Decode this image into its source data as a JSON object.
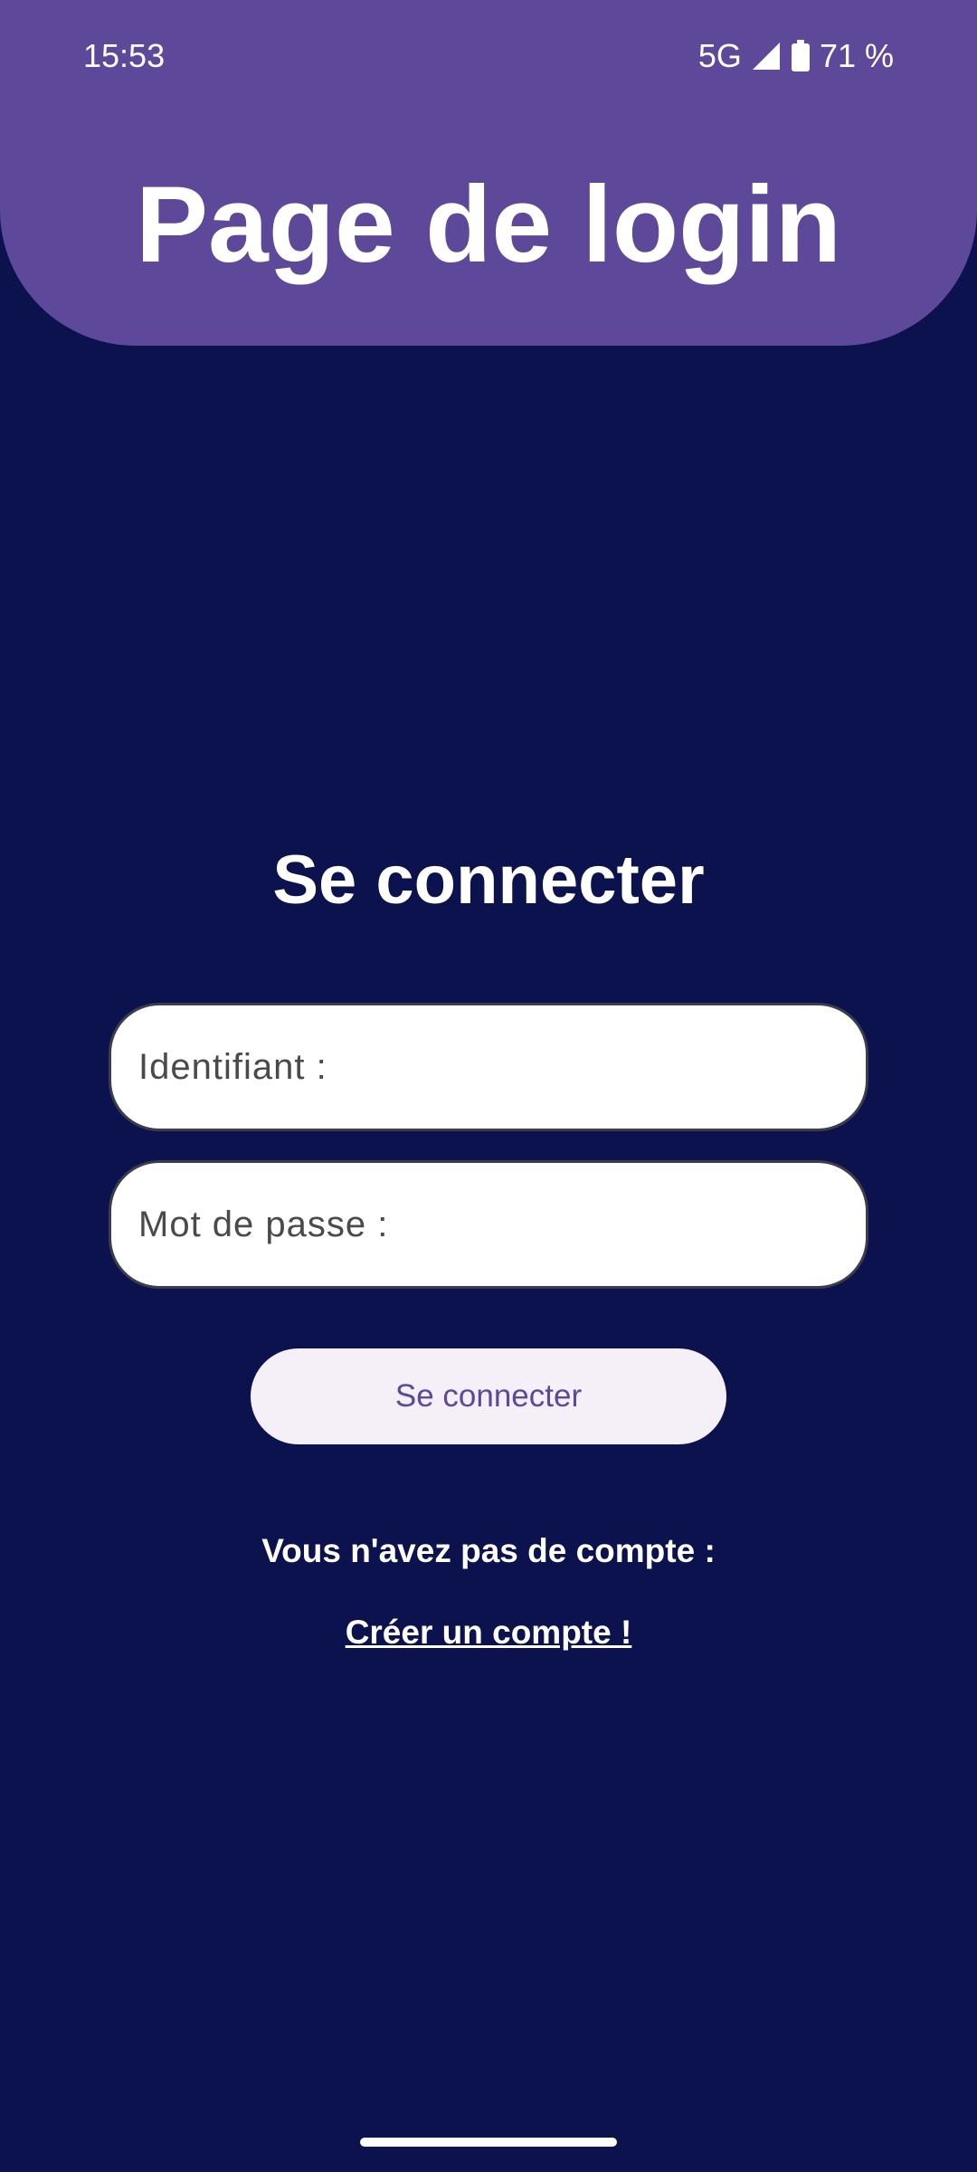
{
  "status_bar": {
    "time": "15:53",
    "network": "5G",
    "battery": "71 %"
  },
  "header": {
    "title": "Page de login"
  },
  "login_form": {
    "title": "Se connecter",
    "username_placeholder": "Identifiant :",
    "password_placeholder": "Mot de passe :",
    "submit_label": "Se connecter"
  },
  "signup": {
    "prompt": "Vous n'avez pas de compte :",
    "link_label": "Créer un compte !"
  },
  "icons": {
    "signal": "signal-icon",
    "battery": "battery-icon"
  },
  "colors": {
    "header_bg": "#5d4899",
    "page_bg": "#0c124d",
    "button_bg": "#f5eff8",
    "button_text": "#5d4899"
  }
}
